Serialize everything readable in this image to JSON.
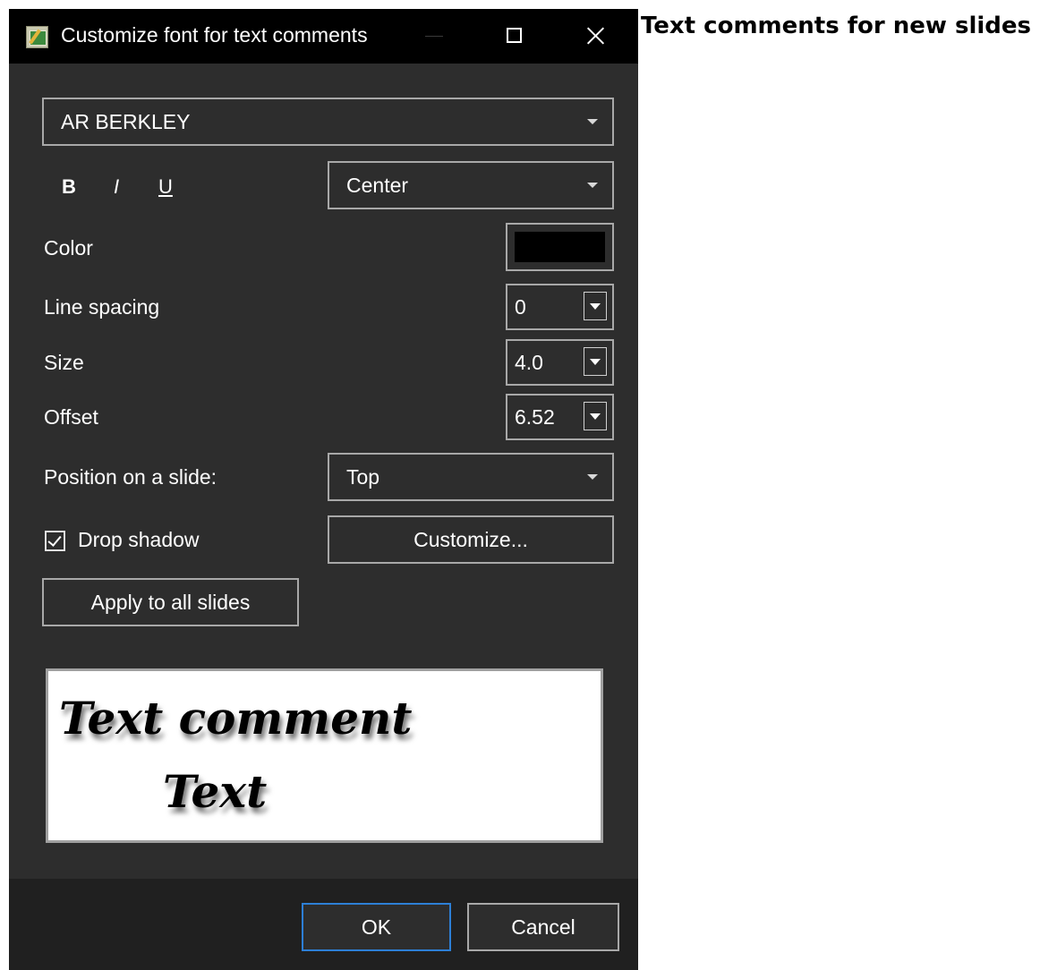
{
  "window": {
    "title": "Customize font for text comments",
    "icon": "app-icon",
    "controls": [
      "minimize-icon",
      "maximize-icon",
      "close-icon"
    ]
  },
  "font": {
    "selected": "AR BERKLEY"
  },
  "format": {
    "bold": "B",
    "italic": "I",
    "underline": "U"
  },
  "alignment": {
    "selected": "Center"
  },
  "color": {
    "label": "Color",
    "value": "#000000"
  },
  "line_spacing": {
    "label": "Line spacing",
    "value": "0"
  },
  "size": {
    "label": "Size",
    "value": "4.0"
  },
  "offset": {
    "label": "Offset",
    "value": "6.52"
  },
  "position": {
    "label": "Position on a slide:",
    "selected": "Top"
  },
  "drop_shadow": {
    "label": "Drop shadow",
    "checked": true
  },
  "customize_button": "Customize...",
  "apply_button": "Apply to all slides",
  "preview": {
    "line1": "Text comment",
    "line2": "Text"
  },
  "footer": {
    "ok": "OK",
    "cancel": "Cancel"
  },
  "side_heading": "Text comments for new slides",
  "colors": {
    "dialog_bg": "#2d2d2d",
    "titlebar_bg": "#000000",
    "ok_border": "#2d7fd6"
  }
}
